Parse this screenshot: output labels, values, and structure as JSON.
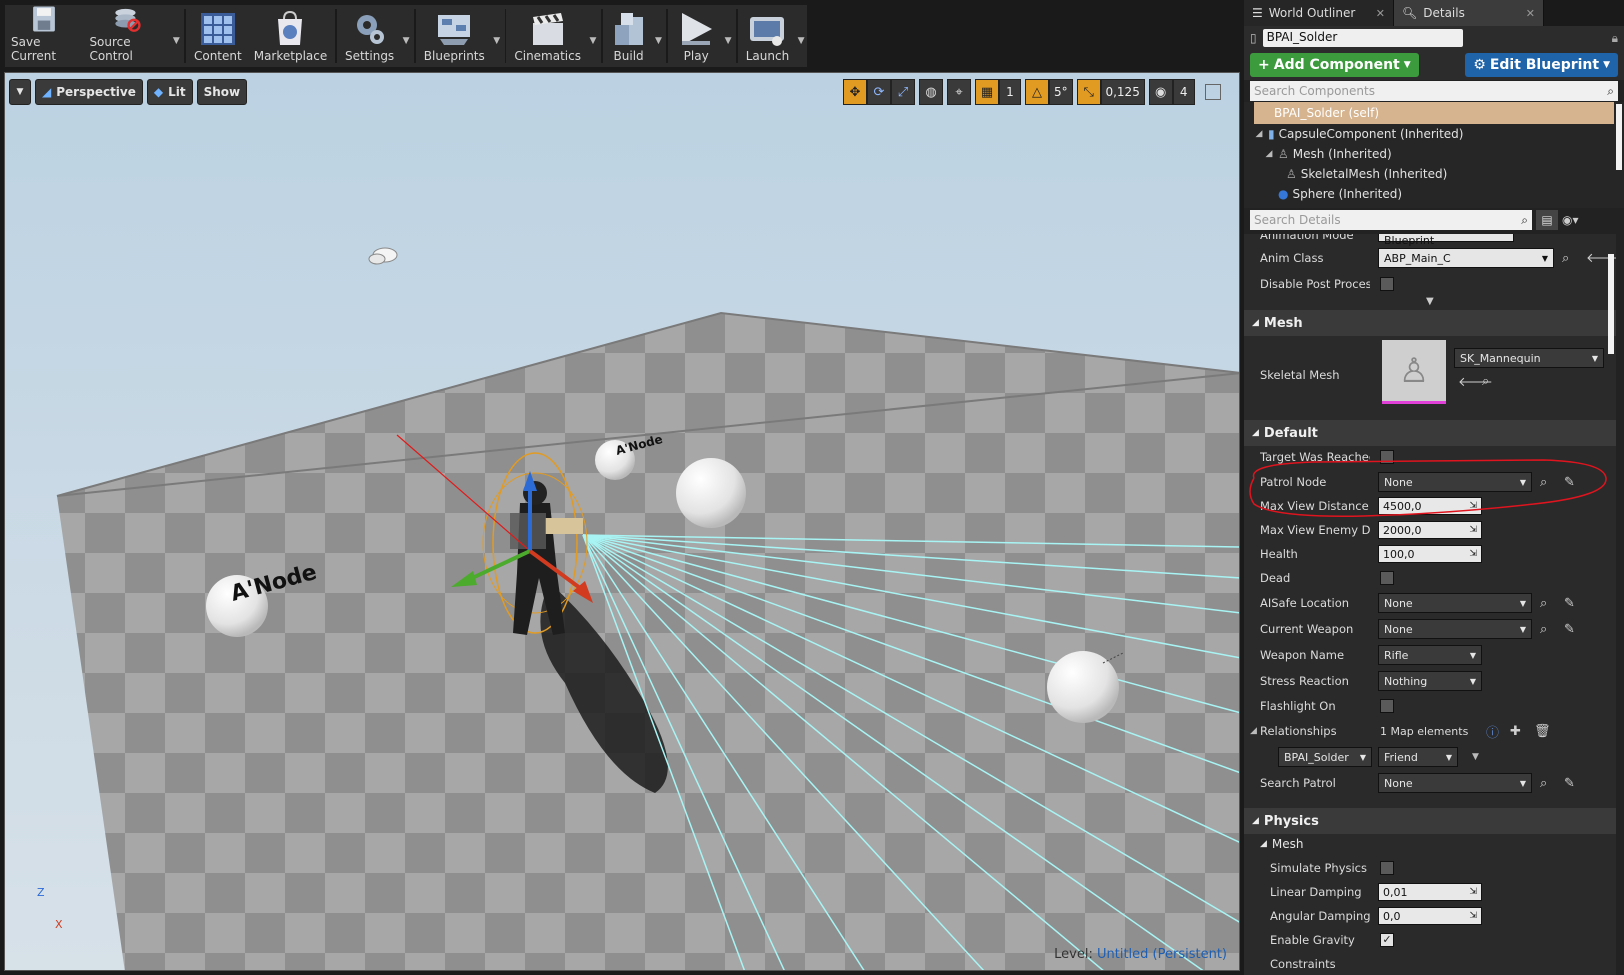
{
  "toolbar": {
    "items": [
      {
        "label": "Save Current",
        "icon": "save-icon"
      },
      {
        "label": "Source Control",
        "icon": "source-control-icon"
      },
      {
        "label": "Content",
        "icon": "content-icon"
      },
      {
        "label": "Marketplace",
        "icon": "marketplace-icon"
      },
      {
        "label": "Settings",
        "icon": "settings-icon"
      },
      {
        "label": "Blueprints",
        "icon": "blueprints-icon"
      },
      {
        "label": "Cinematics",
        "icon": "cinematics-icon"
      },
      {
        "label": "Build",
        "icon": "build-icon"
      },
      {
        "label": "Play",
        "icon": "play-icon"
      },
      {
        "label": "Launch",
        "icon": "launch-icon"
      }
    ]
  },
  "viewport": {
    "perspective_label": "Perspective",
    "lit_label": "Lit",
    "show_label": "Show",
    "grid_snap_value": "1",
    "rotation_snap_value": "5°",
    "scale_snap_value": "0,125",
    "camera_speed_value": "4",
    "node_label": "A'Node",
    "node_label_small": "A'Node",
    "level_prefix": "Level:",
    "level_name": "Untitled (Persistent)",
    "axis_z": "Z",
    "axis_x": "X"
  },
  "right_panel": {
    "tab_outliner": "World Outliner",
    "tab_details": "Details",
    "actor_name": "BPAI_Solder",
    "add_component_label": "Add Component",
    "edit_blueprint_label": "Edit Blueprint",
    "search_components_placeholder": "Search Components",
    "components": {
      "self": "BPAI_Solder (self)",
      "items": [
        "CapsuleComponent (Inherited)",
        "Mesh (Inherited)",
        "SkeletalMesh (Inherited)",
        "Sphere (Inherited)"
      ]
    },
    "search_details_placeholder": "Search Details",
    "details": {
      "animation_mode_label": "Animation Mode",
      "animation_mode_value": "Use Animation Blueprint",
      "anim_class_label": "Anim Class",
      "anim_class_value": "ABP_Main_C",
      "disable_post_process_label": "Disable Post Process",
      "mesh_section": "Mesh",
      "skeletal_mesh_label": "Skeletal Mesh",
      "skeletal_mesh_value": "SK_Mannequin",
      "default_section": "Default",
      "target_was_reached_label": "Target Was Reached",
      "patrol_node_label": "Patrol Node",
      "patrol_node_value": "None",
      "max_view_distance_label": "Max View Distance",
      "max_view_distance_value": "4500,0",
      "max_view_enemy_label": "Max View Enemy Dista",
      "max_view_enemy_value": "2000,0",
      "health_label": "Health",
      "health_value": "100,0",
      "dead_label": "Dead",
      "aisafe_location_label": "AISafe Location",
      "aisafe_location_value": "None",
      "current_weapon_label": "Current Weapon",
      "current_weapon_value": "None",
      "weapon_name_label": "Weapon Name",
      "weapon_name_value": "Rifle",
      "stress_reaction_label": "Stress Reaction",
      "stress_reaction_value": "Nothing",
      "flashlight_on_label": "Flashlight On",
      "relationships_label": "Relationships",
      "relationships_value": "1 Map elements",
      "relationship_key": "BPAI_Solder",
      "relationship_value": "Friend",
      "search_patrol_label": "Search Patrol",
      "search_patrol_value": "None",
      "physics_section": "Physics",
      "physics_mesh_sub": "Mesh",
      "simulate_physics_label": "Simulate Physics",
      "linear_damping_label": "Linear Damping",
      "linear_damping_value": "0,01",
      "angular_damping_label": "Angular Damping",
      "angular_damping_value": "0,0",
      "enable_gravity_label": "Enable Gravity",
      "constraints_label": "Constraints"
    }
  },
  "colors": {
    "accent_orange": "#e29b22",
    "annotation_red": "#e0141e",
    "add_component_green": "#3c9b3c",
    "edit_blueprint_blue": "#1f63a8",
    "sight_cyan": "#9ff0f0"
  }
}
